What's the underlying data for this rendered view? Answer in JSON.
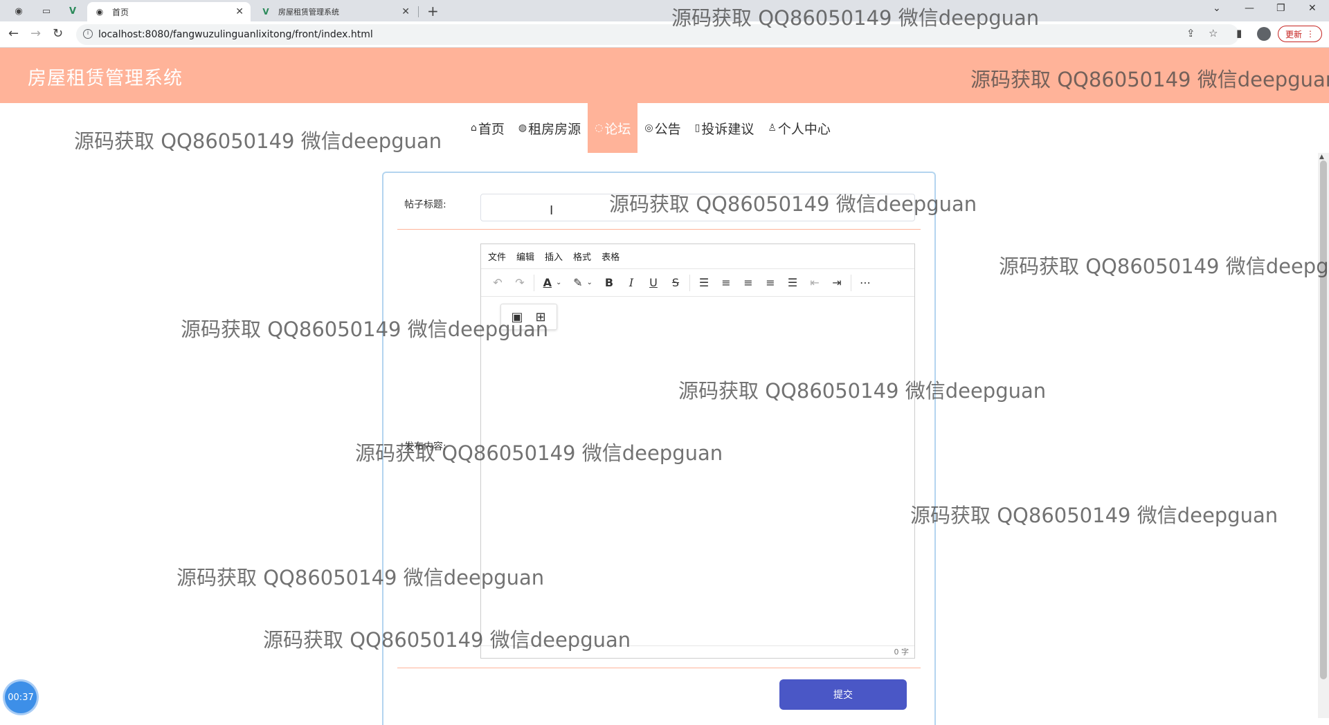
{
  "browser": {
    "tabs": [
      {
        "title": "首页",
        "active": true
      },
      {
        "title": "房屋租赁管理系统",
        "active": false
      }
    ],
    "url": "localhost:8080/fangwuzulinguanlixitong/front/index.html",
    "update_label": "更新"
  },
  "site": {
    "title": "房屋租赁管理系统"
  },
  "nav": {
    "items": [
      {
        "label": "首页",
        "icon": "home-icon"
      },
      {
        "label": "租房房源",
        "icon": "globe-icon"
      },
      {
        "label": "论坛",
        "icon": "chat-icon",
        "active": true
      },
      {
        "label": "公告",
        "icon": "palette-icon"
      },
      {
        "label": "投诉建议",
        "icon": "note-icon"
      },
      {
        "label": "个人中心",
        "icon": "user-icon"
      }
    ]
  },
  "form": {
    "title_label": "帖子标题:",
    "title_value": "",
    "content_label": "发布内容:",
    "submit_label": "提交"
  },
  "editor": {
    "menus": [
      "文件",
      "编辑",
      "插入",
      "格式",
      "表格"
    ],
    "word_count": "0 字"
  },
  "watermark": "源码获取 QQ86050149 微信deepguan",
  "timer": "00:37",
  "colors": {
    "header": "#ffb399",
    "submit": "#4a57c6",
    "card_border": "#b3d4ef"
  }
}
